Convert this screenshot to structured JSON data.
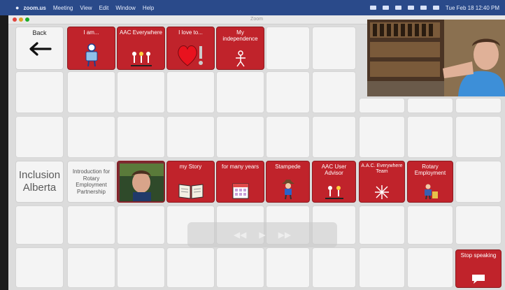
{
  "menubar": {
    "app_name": "zoom.us",
    "menus": [
      "Meeting",
      "View",
      "Edit",
      "Window",
      "Help"
    ],
    "clock": "Tue Feb 18 12:40 PM"
  },
  "window": {
    "title": "Zoom"
  },
  "board": {
    "back_label": "Back",
    "row1": [
      {
        "label": "I am...",
        "icon": "person-icon"
      },
      {
        "label": "AAC Everywhere",
        "icon": "group-icon"
      },
      {
        "label": "I love to...",
        "icon": "heart-icon"
      },
      {
        "label": "My independence",
        "icon": "stick-figure-icon"
      }
    ],
    "inclusion_label": "Inclusion Alberta",
    "intro_label": "Introduction for Rotary Employment Partnership",
    "row4": [
      {
        "label": "my Story",
        "icon": "book-icon"
      },
      {
        "label": "for many years",
        "icon": "calendar-icon"
      },
      {
        "label": "Stampede",
        "icon": "cowboy-icon"
      },
      {
        "label": "AAC User Advisor",
        "icon": "advisor-icon"
      },
      {
        "label": "A.A.C. Everywhere Team",
        "icon": "team-icon"
      },
      {
        "label": "Rotary Employment",
        "icon": "worker-icon"
      }
    ],
    "stop_label": "Stop speaking"
  },
  "colors": {
    "accent": "#c0232b",
    "menubar": "#2a4a8a"
  }
}
